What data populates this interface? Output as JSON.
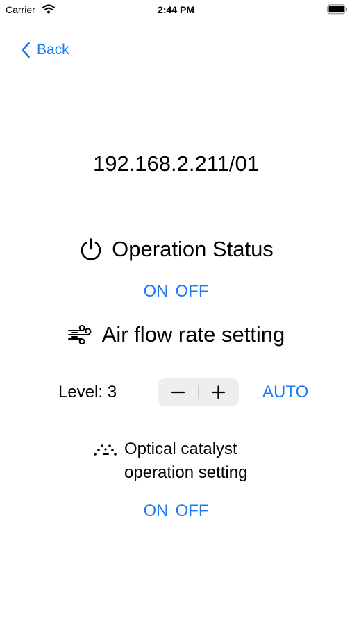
{
  "status_bar": {
    "carrier": "Carrier",
    "time": "2:44 PM",
    "icons": [
      "wifi-icon",
      "battery-icon"
    ]
  },
  "nav": {
    "back_label": "Back",
    "back_icon": "chevron-left-icon"
  },
  "device": {
    "address": "192.168.2.211/01"
  },
  "operation_status": {
    "icon": "power-icon",
    "title": "Operation Status",
    "on_label": "ON",
    "off_label": "OFF"
  },
  "air_flow": {
    "icon": "wind-icon",
    "title": "Air flow rate setting",
    "level_text": "Level: 3",
    "stepper_minus": "−",
    "stepper_plus": "+",
    "auto_label": "AUTO"
  },
  "optical_catalyst": {
    "icon": "sparkle-dots-icon",
    "title_line1": "Optical catalyst",
    "title_line2": "operation setting",
    "on_label": "ON",
    "off_label": "OFF"
  },
  "colors": {
    "accent": "#1a7cf0",
    "background": "#ffffff",
    "text": "#000000",
    "stepper_bg": "#eeeeef"
  }
}
